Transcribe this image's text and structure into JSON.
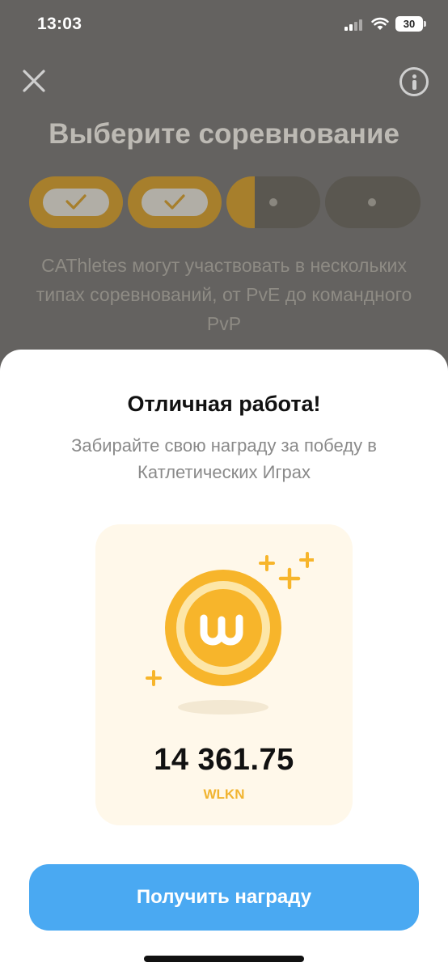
{
  "status_bar": {
    "time": "13:03",
    "battery_level": "30"
  },
  "background_screen": {
    "title": "Выберите соревнование",
    "description": "CAThletes могут участвовать в нескольких типах соревнований, от PvE до командного PvP",
    "progress_steps": [
      {
        "state": "completed"
      },
      {
        "state": "completed"
      },
      {
        "state": "in-progress"
      },
      {
        "state": "pending"
      }
    ],
    "header_icons": [
      "close-icon",
      "info-icon"
    ]
  },
  "reward_sheet": {
    "title": "Отличная работа!",
    "subtitle": "Забирайте свою награду за победу в Катлетических Играх",
    "reward": {
      "amount": "14 361.75",
      "currency": "WLKN",
      "icon": "wlkn-coin-icon"
    },
    "claim_button_label": "Получить награду"
  },
  "colors": {
    "accent_orange": "#f1b431",
    "button_blue": "#4aa9f2",
    "card_background": "#fff8ea"
  }
}
